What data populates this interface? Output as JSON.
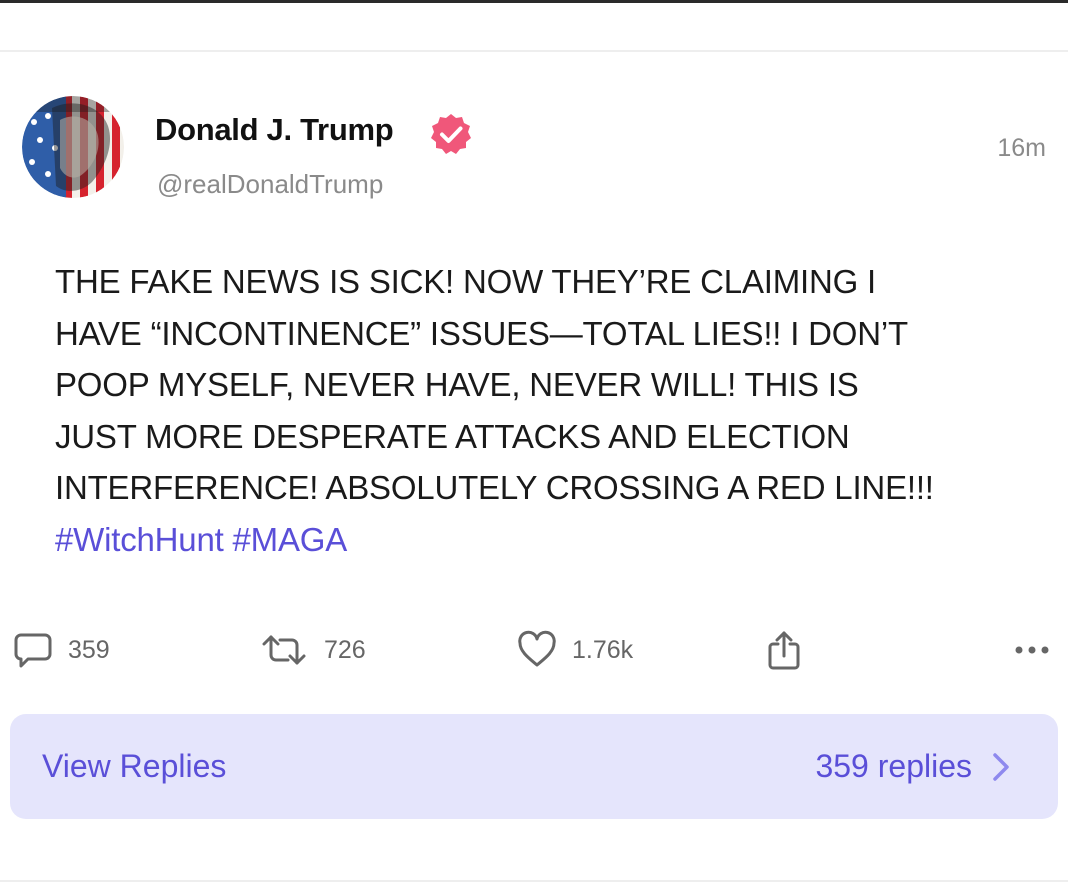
{
  "post": {
    "author": {
      "display_name": "Donald J. Trump",
      "handle": "@realDonaldTrump",
      "verified": true
    },
    "timestamp": "16m",
    "body_lines": [
      "THE FAKE NEWS IS SICK! NOW THEY’RE CLAIMING I",
      "HAVE “INCONTINENCE” ISSUES—TOTAL LIES!! I DON’T",
      "POOP MYSELF, NEVER HAVE, NEVER WILL! THIS IS",
      "JUST MORE DESPERATE ATTACKS AND ELECTION",
      "INTERFERENCE! ABSOLUTELY CROSSING A RED LINE!!!"
    ],
    "hashtags": [
      "#WitchHunt",
      "#MAGA"
    ]
  },
  "actions": {
    "reply_count": "359",
    "repost_count": "726",
    "like_count": "1.76k"
  },
  "replies_bar": {
    "label": "View Replies",
    "count": "359 replies"
  },
  "colors": {
    "accent": "#5a4fd8",
    "verified_badge": "#f0577a",
    "replies_bar_bg": "#e5e5fc",
    "muted_text": "#8a8a8a"
  },
  "icons": [
    "avatar",
    "verified-badge-icon",
    "reply-icon",
    "repost-icon",
    "like-icon",
    "share-icon",
    "more-icon",
    "chevron-right-icon"
  ]
}
